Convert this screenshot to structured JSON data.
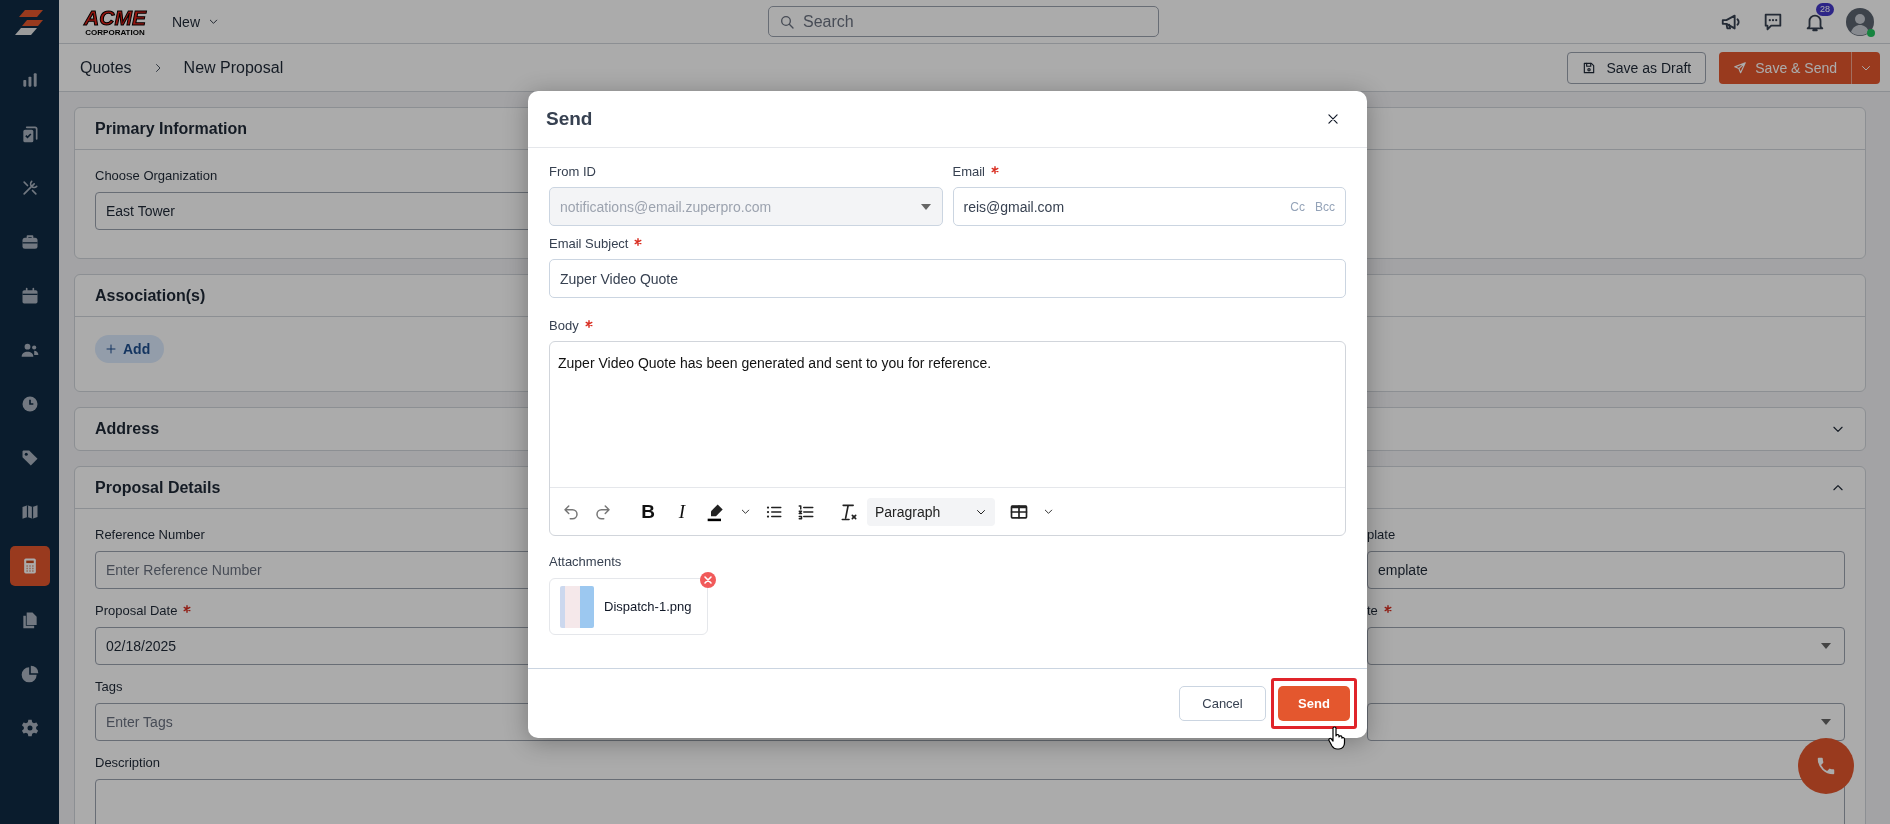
{
  "sidebar": {
    "items": [
      {
        "selected": false
      },
      {
        "selected": false
      },
      {
        "selected": false
      },
      {
        "selected": false
      },
      {
        "selected": false
      },
      {
        "selected": false
      },
      {
        "selected": false
      },
      {
        "selected": false
      },
      {
        "selected": false
      },
      {
        "selected": true
      },
      {
        "selected": false
      },
      {
        "selected": false
      },
      {
        "selected": false
      }
    ]
  },
  "top_bar": {
    "logo": "ACME",
    "logo_subtitle": "CORPORATION",
    "new_menu": "New",
    "search": {
      "placeholder": "Search"
    },
    "notification_count": "28",
    "user_online": true
  },
  "breadcrumb": [
    "Quotes",
    "New Proposal"
  ],
  "actions": {
    "save_draft": "Save as Draft",
    "save_send": "Save & Send"
  },
  "sections": [
    {
      "title": "Primary Information",
      "collapsible": false,
      "expanded": true,
      "fields": [
        {
          "label": "Choose Organization",
          "required": false,
          "kind": "text",
          "value": "East Tower"
        }
      ]
    },
    {
      "title": "Association(s)",
      "collapsible": false,
      "expanded": true,
      "add_button": "Add"
    },
    {
      "title": "Address",
      "collapsible": true,
      "expanded": false
    },
    {
      "title": "Proposal Details",
      "collapsible": true,
      "expanded": true,
      "fields": [
        {
          "label": "Reference Number",
          "required": false,
          "kind": "text",
          "placeholder": "Enter Reference Number"
        },
        {
          "label": "plate",
          "required": false,
          "kind": "text",
          "value": "emplate"
        },
        {
          "label": "Proposal Date",
          "required": true,
          "kind": "text",
          "value": "02/18/2025"
        },
        {
          "label": "te",
          "required": true,
          "kind": "select"
        },
        {
          "label": "Tags",
          "required": false,
          "kind": "text",
          "placeholder": "Enter Tags"
        },
        {
          "required": false,
          "kind": "select"
        },
        {
          "label": "Description",
          "required": false,
          "kind": "textarea"
        }
      ]
    }
  ],
  "modal": {
    "title": "Send",
    "from": {
      "label": "From ID",
      "value": "notifications@email.zuperpro.com",
      "disabled": true
    },
    "email": {
      "label": "Email",
      "required": true,
      "value": "reis@gmail.com",
      "cc": "Cc",
      "bcc": "Bcc"
    },
    "subject": {
      "label": "Email Subject",
      "required": true,
      "value": "Zuper Video Quote"
    },
    "body": {
      "label": "Body",
      "required": true,
      "text": "Zuper Video Quote has been generated and sent to you for reference."
    },
    "toolbar": {
      "bold": "B",
      "italic": "I",
      "block_format": "Paragraph"
    },
    "attachments": {
      "label": "Attachments",
      "files": [
        {
          "name": "Dispatch-1.png"
        }
      ]
    },
    "cancel": "Cancel",
    "send": "Send",
    "send_highlighted": true
  }
}
